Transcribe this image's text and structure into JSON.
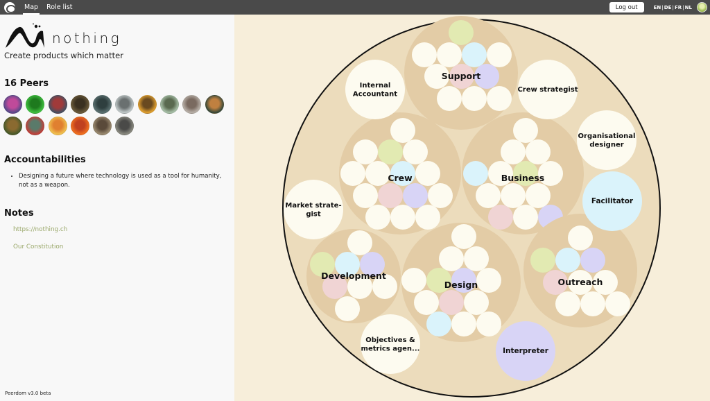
{
  "topbar": {
    "app_logo": "peerdom-logo-icon",
    "tabs": [
      {
        "label": "Map",
        "active": true
      },
      {
        "label": "Role list",
        "active": false
      }
    ],
    "logout_label": "Log out",
    "languages": [
      "EN",
      "DE",
      "FR",
      "NL"
    ],
    "user_avatar": "user-avatar"
  },
  "sidebar": {
    "brand_name": "nothing",
    "tagline": "Create products which matter",
    "peers_heading": "16 Peers",
    "peers": [
      {
        "name": "peer-1",
        "colors": [
          "#5a4a8a",
          "#c04a9a"
        ]
      },
      {
        "name": "peer-2",
        "colors": [
          "#3fbf3f",
          "#1e7a1e"
        ]
      },
      {
        "name": "peer-3",
        "colors": [
          "#4a5060",
          "#a03a3a"
        ]
      },
      {
        "name": "peer-4",
        "colors": [
          "#6a5a3a",
          "#3a3020"
        ]
      },
      {
        "name": "peer-5",
        "colors": [
          "#5a7070",
          "#2f3f3f"
        ]
      },
      {
        "name": "peer-6",
        "colors": [
          "#c0c8c8",
          "#6a7070"
        ]
      },
      {
        "name": "peer-7",
        "colors": [
          "#e0a030",
          "#6a4a20"
        ]
      },
      {
        "name": "peer-8",
        "colors": [
          "#a8c0a8",
          "#5a6a50"
        ]
      },
      {
        "name": "peer-9",
        "colors": [
          "#b8b0a8",
          "#7a6a60"
        ]
      },
      {
        "name": "peer-10",
        "colors": [
          "#3a4a3a",
          "#c08040"
        ]
      },
      {
        "name": "peer-11",
        "colors": [
          "#4a5a2a",
          "#8a6a30"
        ]
      },
      {
        "name": "peer-12",
        "colors": [
          "#c0403a",
          "#5a7a6a"
        ]
      },
      {
        "name": "peer-13",
        "colors": [
          "#f0c050",
          "#e08030"
        ]
      },
      {
        "name": "peer-14",
        "colors": [
          "#f07020",
          "#c04020"
        ]
      },
      {
        "name": "peer-15",
        "colors": [
          "#9a8a70",
          "#5a4a3a"
        ]
      },
      {
        "name": "peer-16",
        "colors": [
          "#8a8a80",
          "#4a4a48"
        ]
      }
    ],
    "accountabilities_heading": "Accountabilities",
    "accountabilities": [
      "Designing a future where technology is used as a tool for humanity, not as a weapon."
    ],
    "notes_heading": "Notes",
    "notes": [
      {
        "label": "https://nothing.ch"
      },
      {
        "label": "Our Constitution"
      }
    ],
    "version": "Peerdom v3.0 beta"
  },
  "map": {
    "colors": {
      "background": "#f7eeda",
      "outer_circle": "#ecdcbc",
      "outer_stroke": "#111111",
      "circle": "#e3cca6",
      "role": "#fdfbf0",
      "green": "#e2eab2",
      "blue": "#daf3fb",
      "pink": "#f0d4d4",
      "lavender": "#d8d4f6"
    },
    "circles": [
      {
        "label": "Support",
        "roles": [
          "green",
          "white",
          "white",
          "blue",
          "white",
          "white",
          "pink",
          "lavender",
          "white",
          "white",
          "white"
        ]
      },
      {
        "label": "Crew",
        "roles": [
          "white",
          "white",
          "green",
          "white",
          "white",
          "white",
          "blue",
          "white",
          "white",
          "pink",
          "lavender",
          "white",
          "white",
          "white",
          "white"
        ]
      },
      {
        "label": "Business",
        "roles": [
          "white",
          "white",
          "white",
          "blue",
          "white",
          "green",
          "white",
          "white",
          "white",
          "white",
          "pink",
          "white",
          "lavender"
        ]
      },
      {
        "label": "Development",
        "roles": [
          "white",
          "green",
          "blue",
          "lavender",
          "pink",
          "white",
          "white",
          "white"
        ]
      },
      {
        "label": "Design",
        "roles": [
          "white",
          "white",
          "white",
          "white",
          "green",
          "lavender",
          "white",
          "white",
          "pink",
          "white",
          "blue",
          "white",
          "white"
        ]
      },
      {
        "label": "Outreach",
        "roles": [
          "white",
          "green",
          "blue",
          "lavender",
          "pink",
          "white",
          "white",
          "white",
          "white",
          "white"
        ]
      }
    ],
    "roles": [
      {
        "label": "Internal Accountant",
        "lines": [
          "Internal",
          "Accountant"
        ],
        "color": "white"
      },
      {
        "label": "Crew strategist",
        "lines": [
          "Crew strategist"
        ],
        "color": "white"
      },
      {
        "label": "Organisational designer",
        "lines": [
          "Organisational",
          "designer"
        ],
        "color": "white"
      },
      {
        "label": "Facilitator",
        "lines": [
          "Facilitator"
        ],
        "color": "blue"
      },
      {
        "label": "Market strategist",
        "lines": [
          "Market strate-",
          "gist"
        ],
        "color": "white"
      },
      {
        "label": "Objectives & metrics agen...",
        "lines": [
          "Objectives &",
          "metrics agen..."
        ],
        "color": "white"
      },
      {
        "label": "Interpreter",
        "lines": [
          "Interpreter"
        ],
        "color": "lavender"
      }
    ]
  }
}
